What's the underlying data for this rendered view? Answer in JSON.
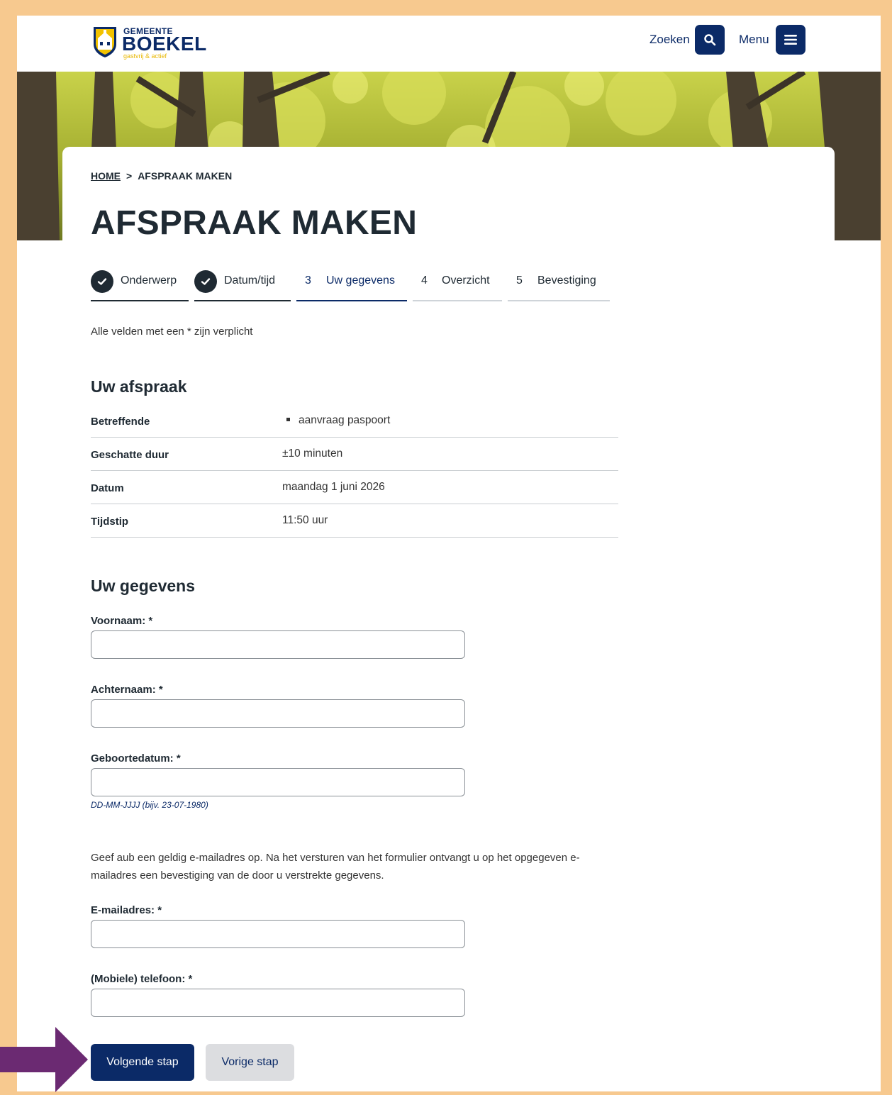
{
  "header": {
    "logo_top": "GEMEENTE",
    "logo_main": "BOEKEL",
    "logo_tagline": "gastvrij & actief",
    "search_label": "Zoeken",
    "menu_label": "Menu"
  },
  "breadcrumb": {
    "home": "HOME",
    "separator": ">",
    "current": "AFSPRAAK MAKEN"
  },
  "page_title": "AFSPRAAK MAKEN",
  "steps": [
    {
      "number": "",
      "label": "Onderwerp",
      "state": "done"
    },
    {
      "number": "",
      "label": "Datum/tijd",
      "state": "done"
    },
    {
      "number": "3",
      "label": "Uw gegevens",
      "state": "active"
    },
    {
      "number": "4",
      "label": "Overzicht",
      "state": "todo"
    },
    {
      "number": "5",
      "label": "Bevestiging",
      "state": "todo"
    }
  ],
  "required_note": "Alle velden met een * zijn verplicht",
  "appointment": {
    "heading": "Uw afspraak",
    "rows": [
      {
        "key": "Betreffende",
        "value": "aanvraag paspoort"
      },
      {
        "key": "Geschatte duur",
        "value": "±10 minuten"
      },
      {
        "key": "Datum",
        "value": "maandag 1 juni 2026"
      },
      {
        "key": "Tijdstip",
        "value": "11:50 uur"
      }
    ]
  },
  "details": {
    "heading": "Uw gegevens",
    "fields": {
      "first_name": {
        "label": "Voornaam: *",
        "value": ""
      },
      "last_name": {
        "label": "Achternaam: *",
        "value": ""
      },
      "birthdate": {
        "label": "Geboortedatum: *",
        "value": "",
        "hint": "DD-MM-JJJJ (bijv. 23-07-1980)"
      },
      "email": {
        "label": "E-mailadres: *",
        "value": ""
      },
      "phone": {
        "label": "(Mobiele) telefoon: *",
        "value": ""
      }
    },
    "email_info": "Geef aub een geldig e-mailadres op. Na het versturen van het formulier ontvangt u op het opgegeven e-mailadres een bevestiging van de door u verstrekte gegevens."
  },
  "buttons": {
    "next": "Volgende stap",
    "prev": "Vorige stap"
  },
  "colors": {
    "brand_navy": "#0b2a67",
    "frame_orange": "#f7c98f",
    "arrow_purple": "#6b2a72",
    "text_dark": "#1f2a33"
  },
  "icons": [
    "shield-logo-icon",
    "search-icon",
    "hamburger-menu-icon",
    "checkmark-icon",
    "arrow-right-icon"
  ]
}
